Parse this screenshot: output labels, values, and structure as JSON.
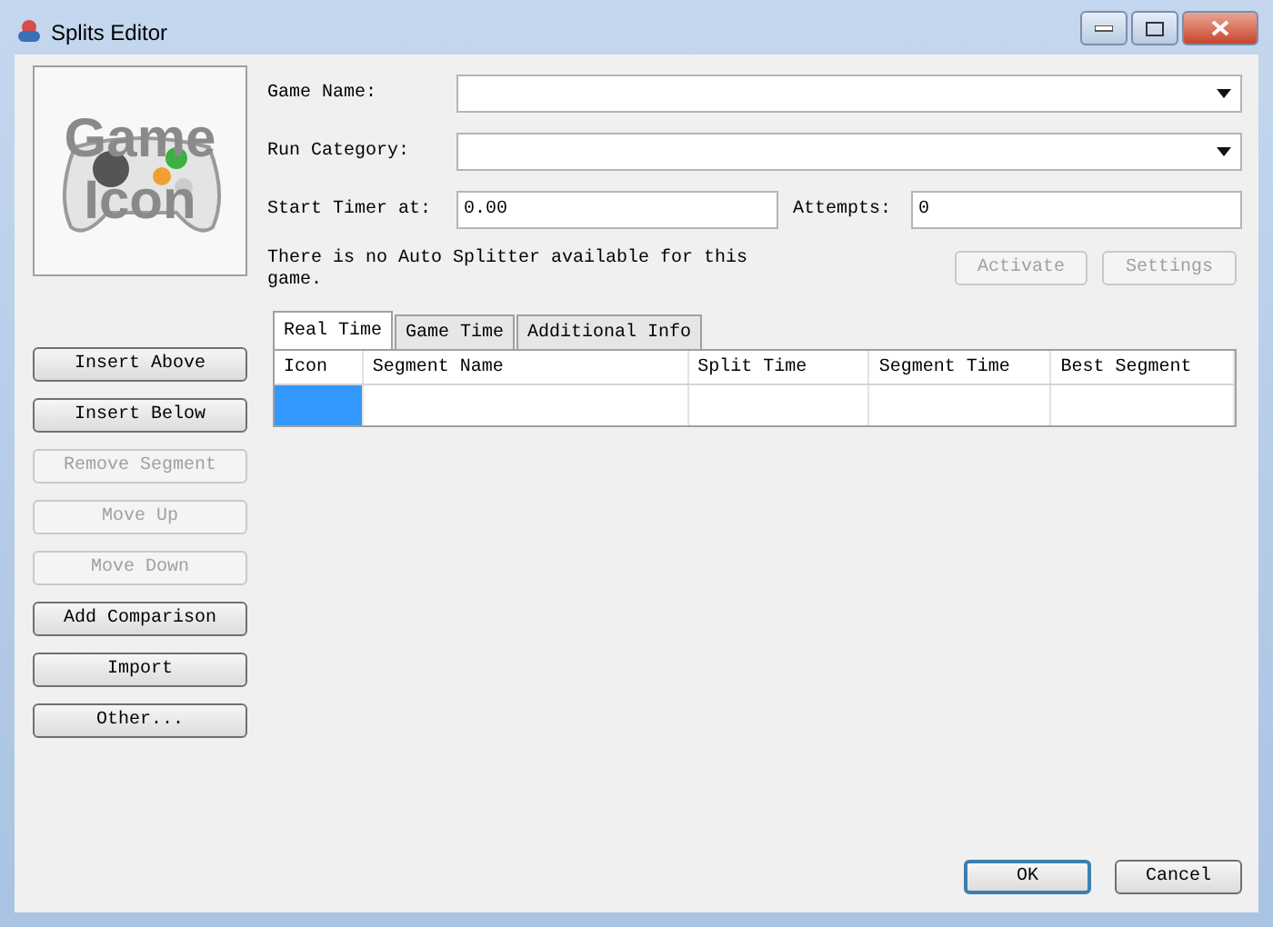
{
  "window": {
    "title": "Splits Editor"
  },
  "game_icon": {
    "lines": [
      "Game",
      "Icon"
    ]
  },
  "game_fields": [
    {
      "label": "Game Name:"
    },
    {
      "label": "Run Category:"
    }
  ],
  "start_timer": {
    "label": "Start Timer at:",
    "value": "0.00"
  },
  "attempts": {
    "label": "Attempts:",
    "value": "0"
  },
  "auto_splitter": {
    "message": "There is no Auto Splitter available for this game.",
    "buttons": [
      {
        "label": "Activate",
        "disabled": true
      },
      {
        "label": "Settings",
        "disabled": true
      }
    ]
  },
  "tabs": [
    {
      "label": "Real Time",
      "selected": true
    },
    {
      "label": "Game Time",
      "selected": false
    },
    {
      "label": "Additional Info",
      "selected": false
    }
  ],
  "table": {
    "columns": [
      "Icon",
      "Segment Name",
      "Split Time",
      "Segment Time",
      "Best Segment"
    ],
    "rows": [
      {
        "selected": true
      }
    ]
  },
  "side_buttons": [
    {
      "label": "Insert Above",
      "disabled": false
    },
    {
      "label": "Insert Below",
      "disabled": false
    },
    {
      "label": "Remove Segment",
      "disabled": true
    },
    {
      "label": "Move Up",
      "disabled": true
    },
    {
      "label": "Move Down",
      "disabled": true
    },
    {
      "label": "Add Comparison",
      "disabled": false
    },
    {
      "label": "Import",
      "disabled": false
    },
    {
      "label": "Other...",
      "disabled": false
    }
  ],
  "dialog_buttons": [
    {
      "label": "OK",
      "default": true
    },
    {
      "label": "Cancel",
      "default": false
    }
  ]
}
